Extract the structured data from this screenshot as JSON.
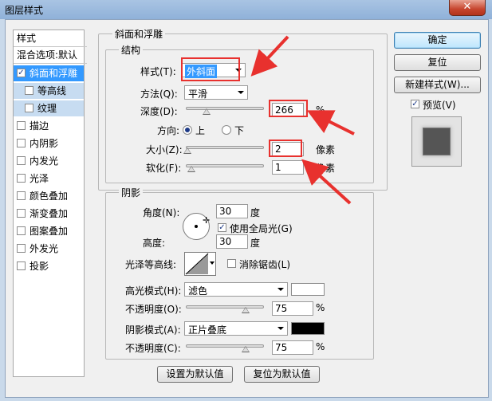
{
  "window": {
    "title": "图层样式",
    "close_label": "✕"
  },
  "style_list": {
    "header": "样式",
    "blend_options": "混合选项:默认",
    "items": [
      {
        "label": "斜面和浮雕",
        "checked": true,
        "selected": true
      },
      {
        "label": "等高线",
        "checked": false,
        "sub": true
      },
      {
        "label": "纹理",
        "checked": false,
        "sub": true
      },
      {
        "label": "描边",
        "checked": false
      },
      {
        "label": "内阴影",
        "checked": false
      },
      {
        "label": "内发光",
        "checked": false
      },
      {
        "label": "光泽",
        "checked": false
      },
      {
        "label": "颜色叠加",
        "checked": false
      },
      {
        "label": "渐变叠加",
        "checked": false
      },
      {
        "label": "图案叠加",
        "checked": false
      },
      {
        "label": "外发光",
        "checked": false
      },
      {
        "label": "投影",
        "checked": false
      }
    ]
  },
  "bevel": {
    "group_title": "斜面和浮雕",
    "structure_title": "结构",
    "style_label": "样式(T):",
    "style_value": "外斜面",
    "method_label": "方法(Q):",
    "method_value": "平滑",
    "depth_label": "深度(D):",
    "depth_value": "266",
    "depth_unit": "%",
    "depth_level": 0.266,
    "direction_label": "方向:",
    "direction_up": "上",
    "direction_down": "下",
    "size_label": "大小(Z):",
    "size_value": "2",
    "size_unit": "像素",
    "soften_label": "软化(F):",
    "soften_value": "1",
    "soften_unit": "像素"
  },
  "shading": {
    "group_title": "阴影",
    "angle_label": "角度(N):",
    "angle_value": "30",
    "angle_unit": "度",
    "global_light_label": "使用全局光(G)",
    "global_light_checked": "✓",
    "altitude_label": "高度:",
    "altitude_value": "30",
    "altitude_unit": "度",
    "gloss_contour_label": "光泽等高线:",
    "anti_alias_label": "消除锯齿(L)",
    "highlight_mode_label": "高光模式(H):",
    "highlight_mode_value": "滤色",
    "highlight_color": "#ffffff",
    "highlight_opacity_label": "不透明度(O):",
    "highlight_opacity_value": "75",
    "highlight_opacity_unit": "%",
    "shadow_mode_label": "阴影模式(A):",
    "shadow_mode_value": "正片叠底",
    "shadow_color": "#000000",
    "shadow_opacity_label": "不透明度(C):",
    "shadow_opacity_value": "75",
    "shadow_opacity_unit": "%"
  },
  "footer": {
    "set_default": "设置为默认值",
    "reset_default": "复位为默认值"
  },
  "actions": {
    "ok": "确定",
    "reset": "复位",
    "new_style": "新建样式(W)...",
    "preview_label": "预览(V)",
    "preview_checked": "✓"
  },
  "annotation_color": "#e8312e"
}
